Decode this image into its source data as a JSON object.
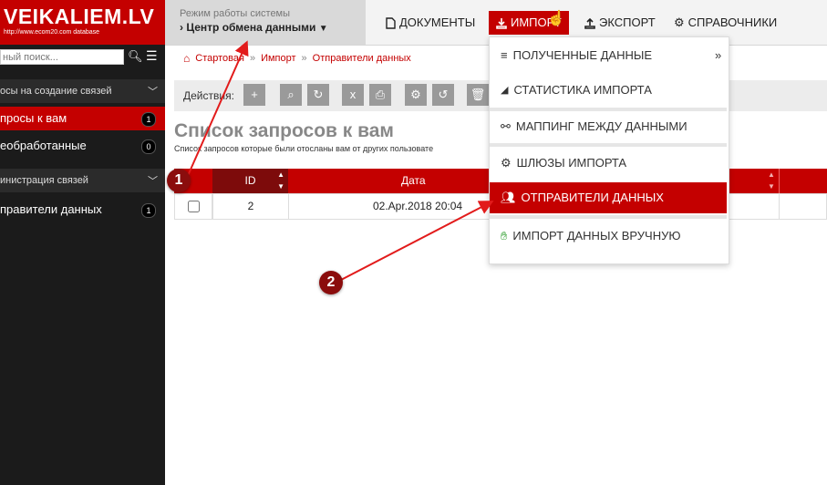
{
  "logo": {
    "title": "VEIKALIEM.LV",
    "subtitle": "http://www.ecom20.com database"
  },
  "mode": {
    "label": "Режим работы системы",
    "value": "Центр обмена данными"
  },
  "nav": [
    {
      "label": "ДОКУМЕНТЫ",
      "icon": "document-icon"
    },
    {
      "label": "ИМПОРТ",
      "icon": "download-icon"
    },
    {
      "label": "ЭКСПОРТ",
      "icon": "upload-icon"
    },
    {
      "label": "СПРАВОЧНИКИ",
      "icon": "gears-icon"
    }
  ],
  "search": {
    "placeholder": "ный поиск..."
  },
  "sidebar": {
    "sections": [
      {
        "label": "осы на создание связей"
      },
      {
        "label": "инистрация связей"
      }
    ],
    "items": [
      {
        "label": "просы к вам",
        "badge": "1"
      },
      {
        "label": "еобработанные",
        "badge": "0"
      },
      {
        "label": "правители данных",
        "badge": "1"
      }
    ]
  },
  "breadcrumb": [
    "Стартовая",
    "Импорт",
    "Отправители данных"
  ],
  "actions": {
    "label": "Действия:"
  },
  "page": {
    "title": "Список запросов к вам",
    "subtitle": "Список запросов которые были отосланы вам от других пользовате"
  },
  "table": {
    "headers": [
      "ID",
      "Дата"
    ],
    "rows": [
      {
        "id": "2",
        "date": "02.Apr.2018 20:04"
      }
    ]
  },
  "dropdown": [
    {
      "label": "ПОЛУЧЕННЫЕ ДАННЫЕ",
      "icon": "database-icon"
    },
    {
      "label": "СТАТИСТИКА ИМПОРТА",
      "icon": "area-chart-icon"
    },
    {
      "label": "МАППИНГ МЕЖДУ ДАННЫМИ",
      "icon": "link-icon"
    },
    {
      "label": "ШЛЮЗЫ ИМПОРТА",
      "icon": "gears-icon"
    },
    {
      "label": "ОТПРАВИТЕЛИ ДАННЫХ",
      "icon": "users-icon"
    },
    {
      "label": "ИМПОРТ ДАННЫХ ВРУЧНУЮ",
      "icon": "hand-icon"
    }
  ],
  "markers": [
    "1",
    "2"
  ],
  "colors": {
    "brand": "#c40000",
    "sidebar": "#1b1b1b",
    "marker": "#8b0d0d"
  }
}
